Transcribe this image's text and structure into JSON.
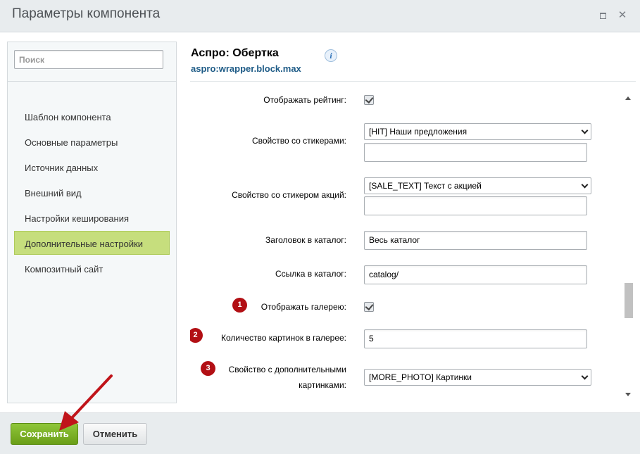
{
  "window": {
    "title": "Параметры компонента",
    "maximize_icon": "maximize-icon",
    "close_icon": "close-icon",
    "close_glyph": "✕"
  },
  "sidebar": {
    "search_placeholder": "Поиск",
    "items": [
      {
        "label": "Шаблон компонента",
        "active": false
      },
      {
        "label": "Основные параметры",
        "active": false
      },
      {
        "label": "Источник данных",
        "active": false
      },
      {
        "label": "Внешний вид",
        "active": false
      },
      {
        "label": "Настройки кеширования",
        "active": false
      },
      {
        "label": "Дополнительные настройки",
        "active": true
      },
      {
        "label": "Композитный сайт",
        "active": false
      }
    ]
  },
  "component": {
    "title": "Аспро: Обертка",
    "code": "aspro:wrapper.block.max",
    "info_glyph": "i"
  },
  "form": {
    "rows": [
      {
        "label": "Отображать рейтинг:",
        "type": "checkbox",
        "checked": true
      },
      {
        "label": "Свойство со стикерами:",
        "type": "select",
        "value": "[HIT] Наши предложения",
        "extra_input": ""
      },
      {
        "label": "Свойство со стикером акций:",
        "type": "select",
        "value": "[SALE_TEXT] Текст с акцией",
        "extra_input": ""
      },
      {
        "label": "Заголовок в каталог:",
        "type": "text",
        "value": "Весь каталог"
      },
      {
        "label": "Ссылка в каталог:",
        "type": "text",
        "value": "catalog/"
      },
      {
        "label": "Отображать галерею:",
        "type": "checkbox",
        "checked": true,
        "badge": "1"
      },
      {
        "label": "Количество картинок в галерее:",
        "type": "text",
        "value": "5",
        "badge": "2"
      },
      {
        "label": "Свойство с дополнительными картинками:",
        "label_line1": "Свойство с дополнительными",
        "label_line2": "картинками:",
        "type": "select",
        "value": "[MORE_PHOTO] Картинки",
        "badge": "3"
      }
    ]
  },
  "footer": {
    "save_label": "Сохранить",
    "cancel_label": "Отменить"
  },
  "colors": {
    "accent_green": "#6a9e17",
    "active_item": "#c6de7d",
    "badge_red": "#b20f14",
    "arrow_red": "#c0141a",
    "link_blue": "#1f5c87"
  }
}
